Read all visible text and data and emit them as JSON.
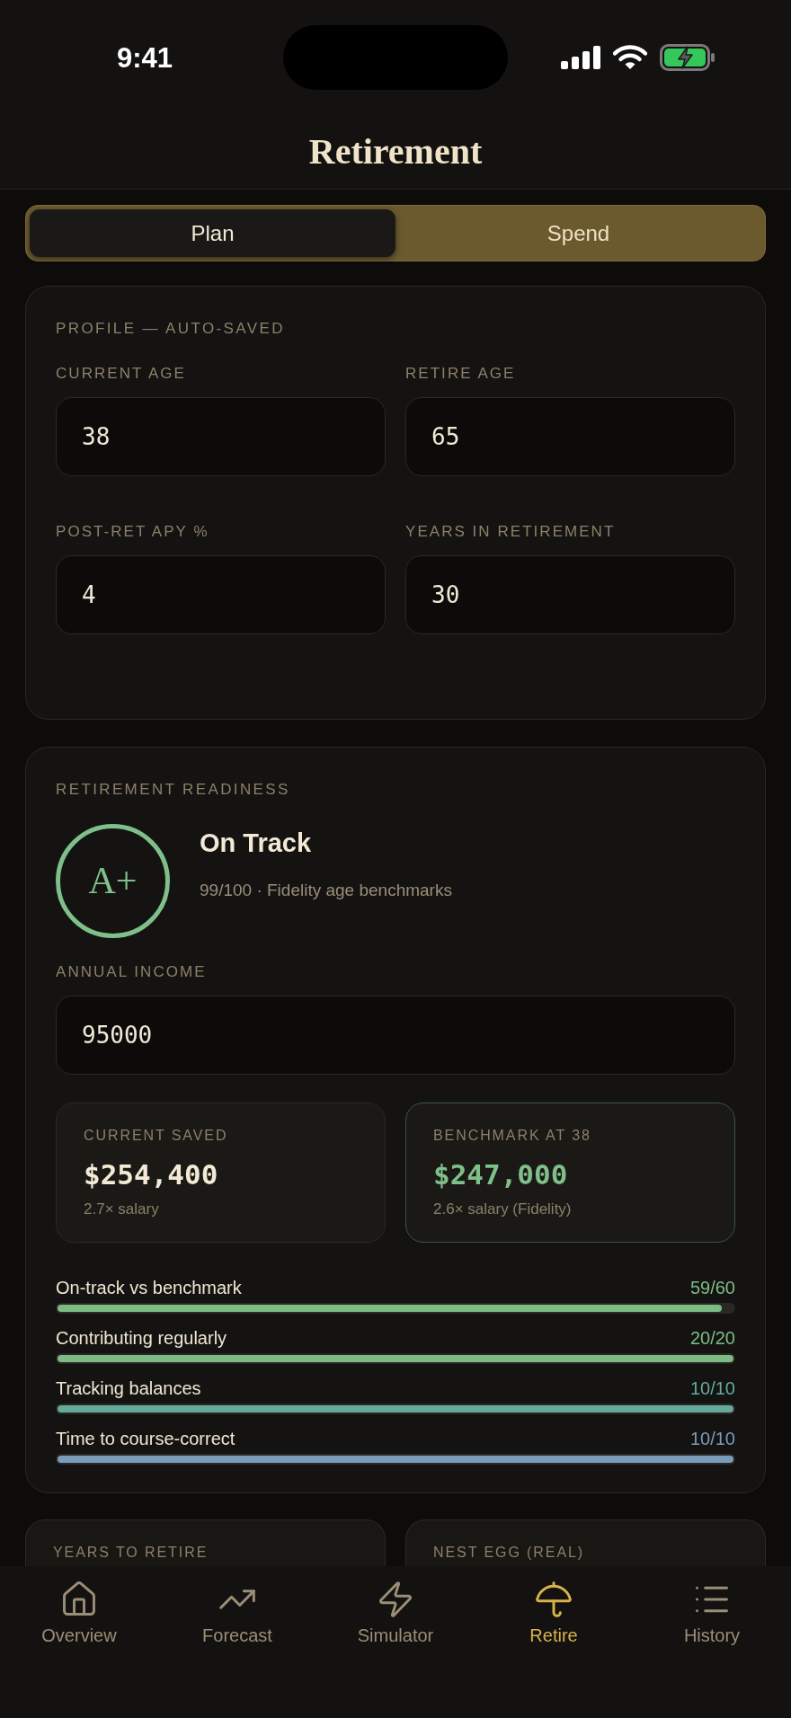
{
  "status_bar": {
    "time": "9:41"
  },
  "header": {
    "title": "Retirement"
  },
  "tabs": [
    {
      "label": "Plan",
      "selected": true
    },
    {
      "label": "Spend",
      "selected": false
    }
  ],
  "profile": {
    "title": "PROFILE — AUTO-SAVED",
    "fields": [
      {
        "label": "CURRENT AGE",
        "value": "38"
      },
      {
        "label": "RETIRE AGE",
        "value": "65"
      },
      {
        "label": "POST-RET APY %",
        "value": "4"
      },
      {
        "label": "YEARS IN RETIREMENT",
        "value": "30"
      }
    ]
  },
  "readiness": {
    "title": "RETIREMENT READINESS",
    "grade": "A+",
    "status": "On Track",
    "summary": "99/100 · Fidelity age benchmarks",
    "income": {
      "label": "ANNUAL INCOME",
      "value": "95000"
    },
    "stats": [
      {
        "label": "CURRENT SAVED",
        "value": "$254,400",
        "note": "2.7× salary",
        "highlighted": false
      },
      {
        "label": "BENCHMARK AT 38",
        "value": "$247,000",
        "note": "2.6× salary (Fidelity)",
        "highlighted": true
      }
    ],
    "scores": [
      {
        "label": "On-track vs benchmark",
        "reading": "59/60",
        "level": 0.983,
        "color": "#7dbb85"
      },
      {
        "label": "Contributing regularly",
        "reading": "20/20",
        "level": 1,
        "color": "#7dbb85"
      },
      {
        "label": "Tracking balances",
        "reading": "10/10",
        "level": 1,
        "color": "#65a99a"
      },
      {
        "label": "Time to course-correct",
        "reading": "10/10",
        "level": 1,
        "color": "#7a9cbb"
      }
    ]
  },
  "summary_cards": [
    {
      "label": "YEARS TO RETIRE"
    },
    {
      "label": "NEST EGG (REAL)"
    }
  ],
  "nav": [
    {
      "label": "Overview",
      "selected": false
    },
    {
      "label": "Forecast",
      "selected": false
    },
    {
      "label": "Simulator",
      "selected": false
    },
    {
      "label": "Retire",
      "selected": true
    },
    {
      "label": "History",
      "selected": false
    }
  ]
}
